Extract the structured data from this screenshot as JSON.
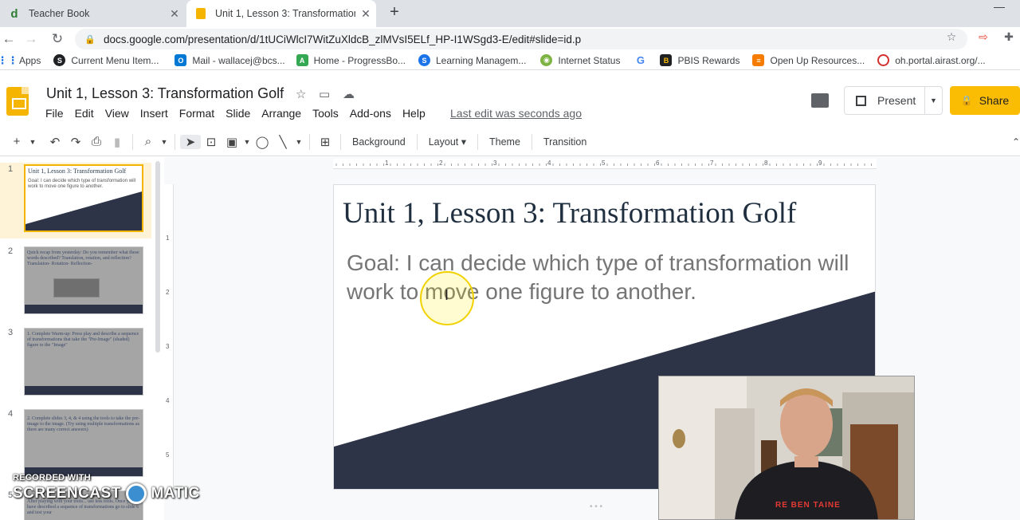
{
  "browser": {
    "tabs": [
      {
        "title": "Teacher Book",
        "icon": "d-favicon",
        "active": false
      },
      {
        "title": "Unit 1, Lesson 3: Transformation",
        "icon": "slides-favicon",
        "active": true
      }
    ],
    "url": "docs.google.com/presentation/d/1tUCiWlcI7WitZuXldcB_zlMVsI5ELf_HP-I1WSgd3-E/edit#slide=id.p",
    "bookmarks": [
      {
        "label": "Apps",
        "icon": "apps-grid-icon",
        "color": "#1a73e8"
      },
      {
        "label": "Current Menu Item...",
        "icon": "s-logo-icon",
        "color": "#202124"
      },
      {
        "label": "Mail - wallacej@bcs...",
        "icon": "outlook-icon",
        "color": "#0078d4"
      },
      {
        "label": "Home - ProgressBo...",
        "icon": "progressbook-icon",
        "color": "#34a853"
      },
      {
        "label": "Learning Managem...",
        "icon": "schoology-icon",
        "color": "#1a73e8"
      },
      {
        "label": "Internet Status",
        "icon": "status-icon",
        "color": "#7cb342"
      },
      {
        "label": "",
        "icon": "google-icon",
        "color": "#4285f4"
      },
      {
        "label": "PBIS Rewards",
        "icon": "pbis-icon",
        "color": "#fbbc04"
      },
      {
        "label": "Open Up Resources...",
        "icon": "openup-icon",
        "color": "#f57c00"
      },
      {
        "label": "oh.portal.airast.org/...",
        "icon": "circle-icon",
        "color": "#d32f2f"
      }
    ]
  },
  "app": {
    "title": "Unit 1, Lesson 3: Transformation Golf",
    "menu": [
      "File",
      "Edit",
      "View",
      "Insert",
      "Format",
      "Slide",
      "Arrange",
      "Tools",
      "Add-ons",
      "Help"
    ],
    "last_edit": "Last edit was seconds ago",
    "present_label": "Present",
    "share_label": "Share",
    "toolbar_text_buttons": [
      "Background",
      "Layout",
      "Theme",
      "Transition"
    ]
  },
  "filmstrip": {
    "slides": [
      {
        "num": "1",
        "title": "Unit 1, Lesson 3: Transformation Golf",
        "text": "Goal: I can decide which type of transformation will work to move one figure to another."
      },
      {
        "num": "2",
        "text": "Quick recap from yesterday: Do you remember what these words described? Translation, rotation, and reflection? Translation- Rotation- Reflection-"
      },
      {
        "num": "3",
        "text": "1. Complete Warm-up: Press play and describe a sequence of transformations that take the \"Pre-Image\" (shaded) figure to the \"Image\""
      },
      {
        "num": "4",
        "text": "2. Complete slides 3, 4, & 4 using the tools to take the pre-image to the image. (Try using multiple transformations as there are many correct answers)"
      },
      {
        "num": "5",
        "text": "After playing with your tools... use less tools. Once you have described a sequence of transformations go to slide 6 and test your"
      }
    ]
  },
  "ruler": {
    "h_labels": [
      "1",
      "2",
      "3",
      "4",
      "5",
      "6",
      "7",
      "8",
      "9"
    ],
    "v_labels": [
      "1",
      "2",
      "3",
      "4",
      "5"
    ]
  },
  "slide": {
    "title": "Unit 1, Lesson 3: Transformation Golf",
    "body": "Goal: I can decide which type of transformation will work to move one figure to another.",
    "accent_color": "#2d3447"
  },
  "overlay": {
    "watermark_line1": "RECORDED WITH",
    "watermark_line2": "SCREENCAST",
    "watermark_line3": "MATIC",
    "shirt_text": "RE BEN TAINE"
  }
}
